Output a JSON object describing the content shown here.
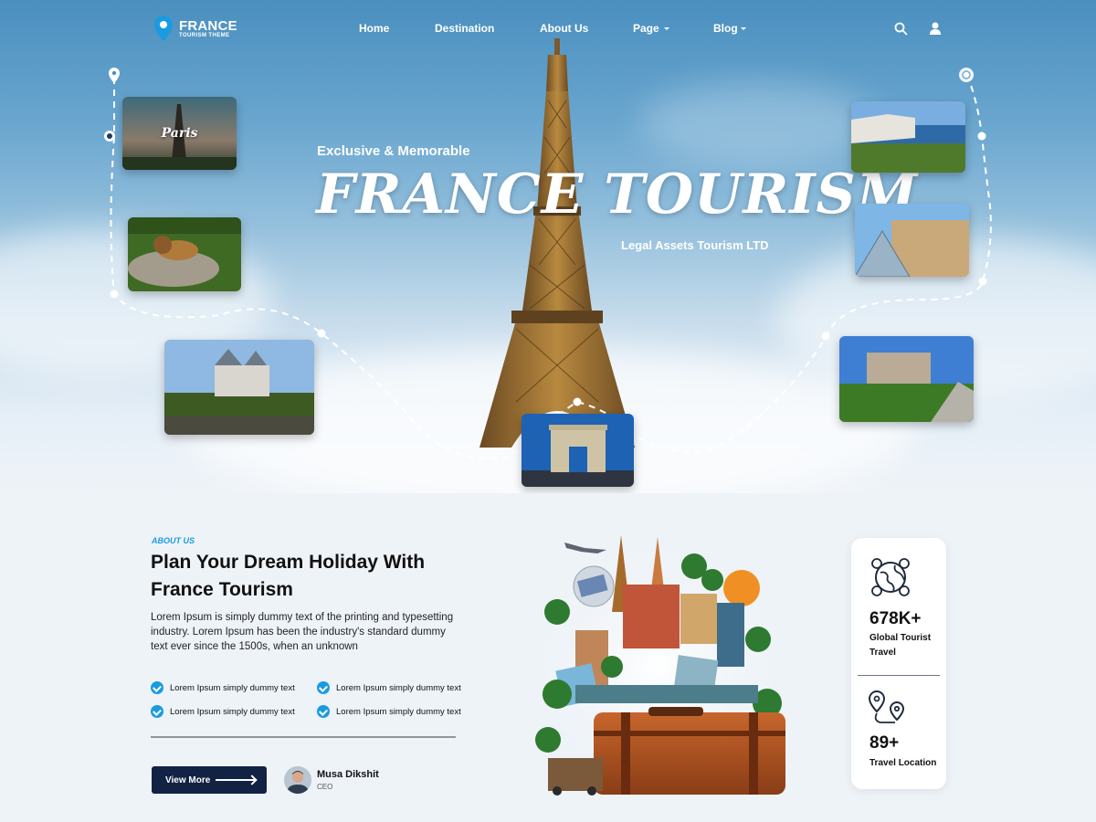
{
  "brand": {
    "name": "FRANCE",
    "tagline": "TOURISM THEME"
  },
  "nav": {
    "items": [
      {
        "label": "Home"
      },
      {
        "label": "Destination"
      },
      {
        "label": "About Us"
      },
      {
        "label": "Page"
      },
      {
        "label": "Blog"
      }
    ]
  },
  "hero": {
    "subtitle": "Exclusive & Memorable",
    "title": "FRANCE TOURISM",
    "company": "Legal Assets Tourism LTD",
    "photos": [
      {
        "label": "Paris"
      }
    ]
  },
  "about": {
    "tag": "ABOUT US",
    "title": "Plan Your Dream Holiday With France Tourism",
    "text": "Lorem Ipsum is simply dummy text of the printing and typesetting industry. Lorem Ipsum has been the industry's standard dummy text ever since the 1500s, when an unknown",
    "checks": [
      "Lorem Ipsum simply dummy text",
      "Lorem Ipsum simply dummy text",
      "Lorem Ipsum simply dummy text",
      "Lorem Ipsum simply dummy text"
    ],
    "button": "View More",
    "person": {
      "name": "Musa Dikshit",
      "role": "CEO"
    }
  },
  "stats": [
    {
      "value": "678K+",
      "label": "Global Tourist Travel"
    },
    {
      "value": "89+",
      "label": "Travel Location"
    }
  ],
  "colors": {
    "accent": "#1a9be0",
    "navy": "#122244",
    "sky": "#5a9bc8"
  }
}
